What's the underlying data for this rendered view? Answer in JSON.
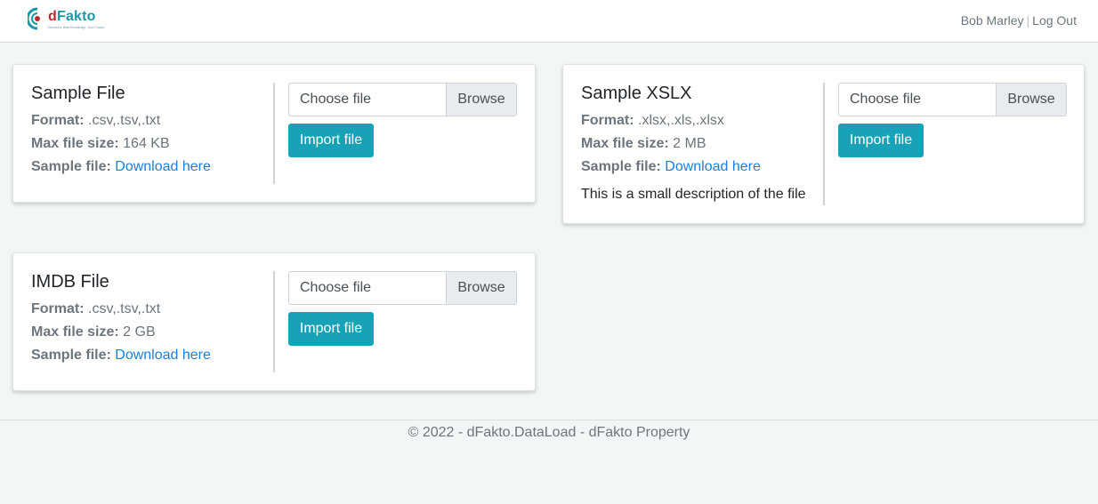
{
  "header": {
    "logo_d": "d",
    "logo_rest": "Fakto",
    "logo_tagline": "Decisions. Best Knowledge. Your Choice.",
    "user_name": "Bob Marley",
    "separator": "|",
    "logout_label": "Log Out"
  },
  "cards": [
    {
      "title": "Sample File",
      "format_label": "Format:",
      "format_value": ".csv,.tsv,.txt",
      "max_size_label": "Max file size:",
      "max_size_value": "164 KB",
      "sample_label": "Sample file:",
      "sample_link": "Download here",
      "description": "",
      "file_placeholder": "Choose file",
      "browse_label": "Browse",
      "import_label": "Import file"
    },
    {
      "title": "Sample XSLX",
      "format_label": "Format:",
      "format_value": ".xlsx,.xls,.xlsx",
      "max_size_label": "Max file size:",
      "max_size_value": "2 MB",
      "sample_label": "Sample file:",
      "sample_link": "Download here",
      "description": "This is a small description of the file",
      "file_placeholder": "Choose file",
      "browse_label": "Browse",
      "import_label": "Import file"
    },
    {
      "title": "IMDB File",
      "format_label": "Format:",
      "format_value": ".csv,.tsv,.txt",
      "max_size_label": "Max file size:",
      "max_size_value": "2 GB",
      "sample_label": "Sample file:",
      "sample_link": "Download here",
      "description": "",
      "file_placeholder": "Choose file",
      "browse_label": "Browse",
      "import_label": "Import file"
    }
  ],
  "footer": {
    "text": "© 2022 - dFakto.DataLoad - dFakto Property"
  },
  "colors": {
    "accent": "#17a2b8",
    "link": "#1a7fe0",
    "brand_red": "#c0262f",
    "brand_teal": "#1a98a8"
  }
}
